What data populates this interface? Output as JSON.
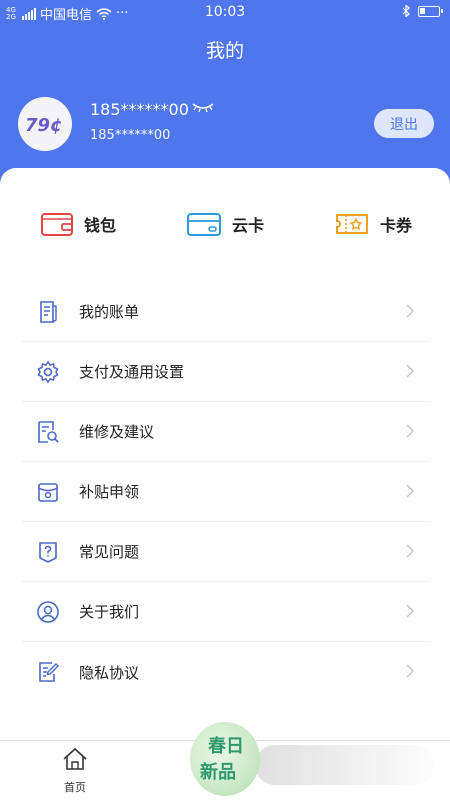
{
  "status_bar": {
    "carrier": "中国电信",
    "dots": "···",
    "net_top": "4G",
    "net_bottom": "2G",
    "time": "10:03",
    "battery_level": 0.3
  },
  "header": {
    "title": "我的"
  },
  "user": {
    "avatar_text": "79¢",
    "name": "185******00",
    "phone": "185******00",
    "logout_label": "退出"
  },
  "quick_actions": [
    {
      "label": "钱包",
      "icon": "wallet-icon",
      "color": "#e64545"
    },
    {
      "label": "云卡",
      "icon": "card-icon",
      "color": "#2a9be0"
    },
    {
      "label": "卡券",
      "icon": "coupon-icon",
      "color": "#f0a020"
    }
  ],
  "menu": [
    {
      "label": "我的账单",
      "icon": "bill-icon"
    },
    {
      "label": "支付及通用设置",
      "icon": "gear-icon"
    },
    {
      "label": "维修及建议",
      "icon": "repair-icon"
    },
    {
      "label": "补贴申领",
      "icon": "subsidy-icon"
    },
    {
      "label": "常见问题",
      "icon": "question-icon"
    },
    {
      "label": "关于我们",
      "icon": "user-icon"
    },
    {
      "label": "隐私协议",
      "icon": "privacy-icon"
    }
  ],
  "tabbar": {
    "home_label": "首页"
  },
  "promo": {
    "line1": "春日",
    "line2": "新品"
  },
  "colors": {
    "brand": "#4f76ec",
    "menu_icon": "#4a68c8"
  }
}
